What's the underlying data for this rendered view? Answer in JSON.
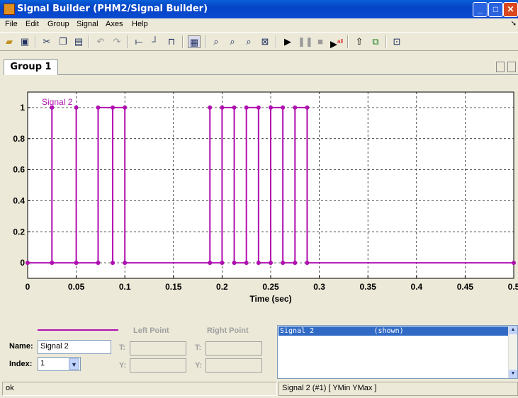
{
  "window": {
    "title": "Signal Builder (PHM2/Signal Builder)"
  },
  "menu": [
    "File",
    "Edit",
    "Group",
    "Signal",
    "Axes",
    "Help"
  ],
  "toolbar": {
    "icons": [
      "open-icon",
      "save-icon",
      "cut-icon",
      "copy-icon",
      "paste-icon",
      "undo-icon",
      "redo-icon",
      "constant-segment-icon",
      "step-icon",
      "pulse-icon",
      "grid-icon",
      "zoom-xy-icon",
      "zoom-x-icon",
      "zoom-y-icon",
      "fit-icon",
      "play-icon",
      "pause-icon",
      "stop-icon",
      "play-all-icon",
      "up-arrow-icon",
      "simulink-icon",
      "help-icon"
    ],
    "play_all_label": "all"
  },
  "tabs": [
    "Group 1"
  ],
  "chart_data": {
    "type": "line",
    "series": [
      {
        "name": "Signal 2",
        "color": "#b010b0",
        "x": [
          0,
          0.025,
          0.025,
          0.025,
          0.025,
          0.05,
          0.05,
          0.05,
          0.05,
          0.0725,
          0.0725,
          0.0875,
          0.0875,
          0.0875,
          0.0875,
          0.1,
          0.1,
          0.1875,
          0.1875,
          0.1875,
          0.1875,
          0.2,
          0.2,
          0.2125,
          0.2125,
          0.225,
          0.225,
          0.2375,
          0.2375,
          0.25,
          0.25,
          0.2625,
          0.2625,
          0.275,
          0.275,
          0.2875,
          0.2875,
          0.5
        ],
        "y": [
          0,
          0,
          1,
          1,
          0,
          0,
          1,
          1,
          0,
          0,
          1,
          1,
          0,
          0,
          1,
          1,
          0,
          0,
          1,
          1,
          0,
          0,
          1,
          1,
          0,
          0,
          1,
          1,
          0,
          0,
          1,
          1,
          0,
          0,
          1,
          1,
          0,
          0
        ]
      }
    ],
    "series_label": "Signal 2",
    "xlabel": "Time (sec)",
    "ylabel": "",
    "xlim": [
      0,
      0.5
    ],
    "ylim": [
      -0.1,
      1.1
    ],
    "xticks": [
      "0",
      "0.05",
      "0.1",
      "0.15",
      "0.2",
      "0.25",
      "0.3",
      "0.35",
      "0.4",
      "0.45",
      "0.5"
    ],
    "yticks": [
      "0",
      "0.2",
      "0.4",
      "0.6",
      "0.8",
      "1"
    ],
    "ytick_values": [
      0,
      0.2,
      0.4,
      0.6,
      0.8,
      1
    ],
    "grid": true
  },
  "props": {
    "left_point": "Left Point",
    "right_point": "Right Point",
    "name_label": "Name:",
    "name_value": "Signal 2",
    "index_label": "Index:",
    "index_value": "1",
    "t_label": "T:",
    "y_label": "Y:"
  },
  "signal_list": {
    "selected_name": "Signal 2",
    "selected_state": "(shown)"
  },
  "status": {
    "left": "ok",
    "right": "Signal 2 (#1)  [ YMin YMax ]"
  }
}
